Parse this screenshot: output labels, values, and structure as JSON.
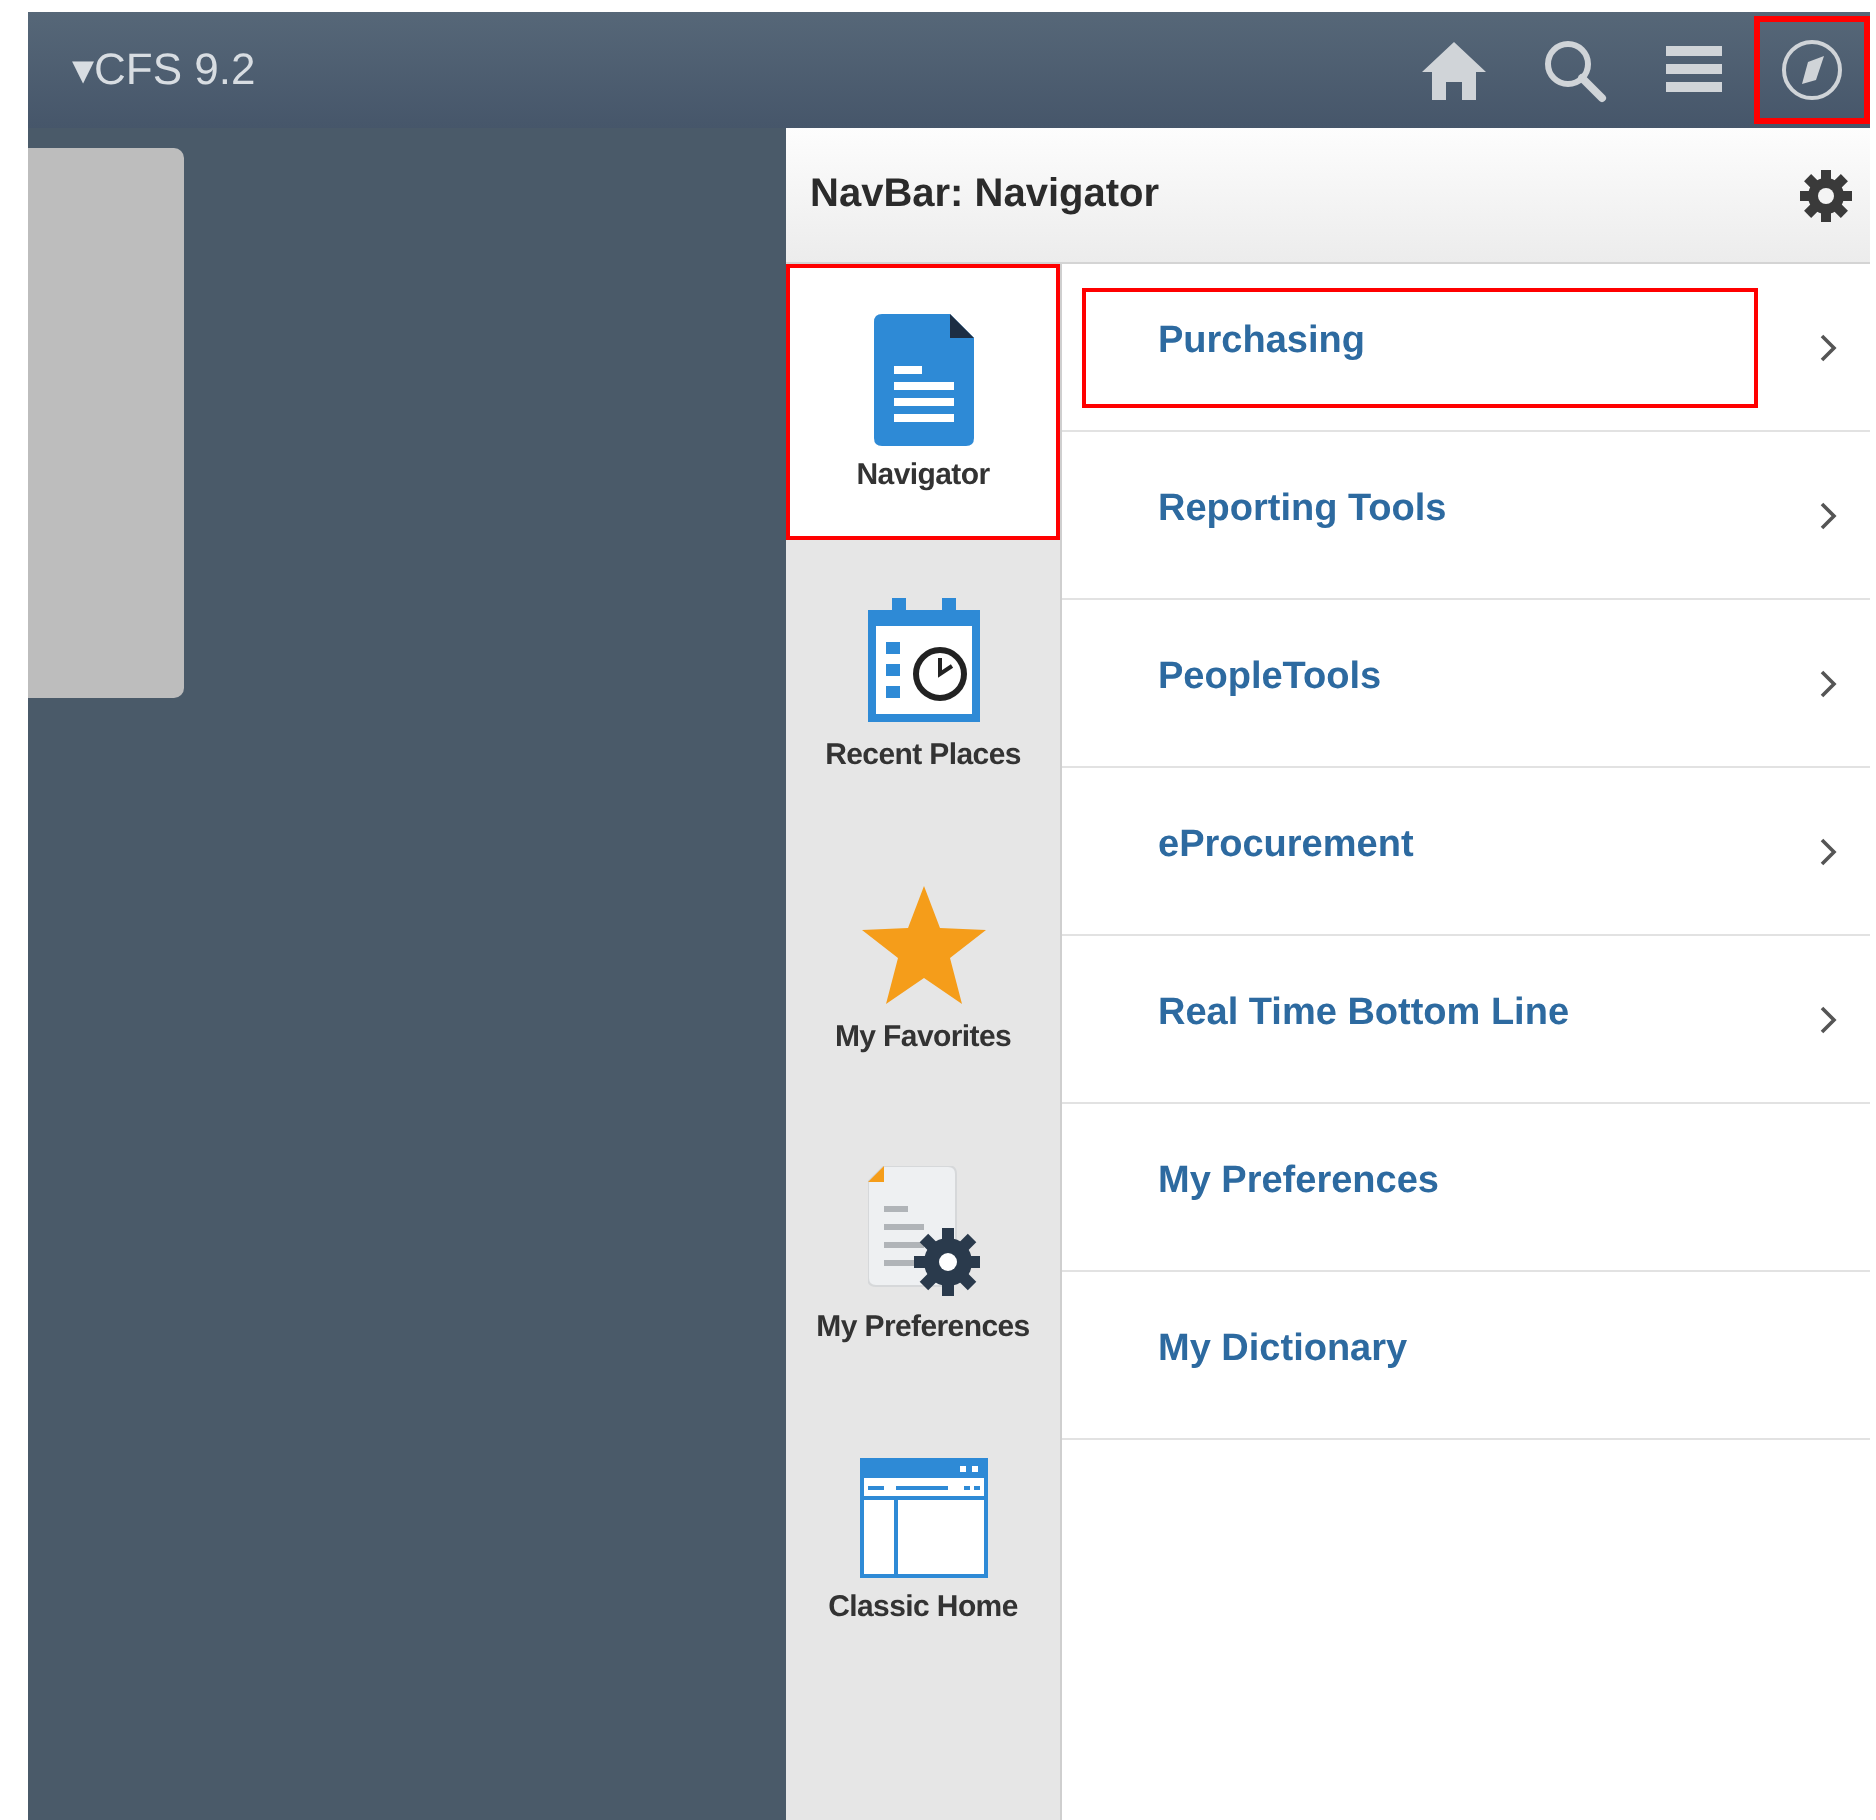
{
  "header": {
    "title": "▾CFS 9.2",
    "icons": [
      {
        "kind": "home",
        "highlighted": false
      },
      {
        "kind": "search",
        "highlighted": false
      },
      {
        "kind": "menu",
        "highlighted": false
      },
      {
        "kind": "compass",
        "highlighted": true
      }
    ]
  },
  "panel": {
    "title": "NavBar: Navigator",
    "tiles": [
      {
        "kind": "document",
        "label": "Navigator",
        "selected": true,
        "highlighted": true
      },
      {
        "kind": "calendar",
        "label": "Recent Places",
        "selected": false,
        "highlighted": false
      },
      {
        "kind": "star",
        "label": "My Favorites",
        "selected": false,
        "highlighted": false
      },
      {
        "kind": "preferences",
        "label": "My Preferences",
        "selected": false,
        "highlighted": false
      },
      {
        "kind": "classic",
        "label": "Classic Home",
        "selected": false,
        "highlighted": false
      }
    ],
    "items": [
      {
        "label": "Purchasing",
        "has_children": true,
        "highlighted": true
      },
      {
        "label": "Reporting Tools",
        "has_children": true,
        "highlighted": false
      },
      {
        "label": "PeopleTools",
        "has_children": true,
        "highlighted": false
      },
      {
        "label": "eProcurement",
        "has_children": true,
        "highlighted": false
      },
      {
        "label": "Real Time Bottom Line",
        "has_children": true,
        "highlighted": false
      },
      {
        "label": "My Preferences",
        "has_children": false,
        "highlighted": false
      },
      {
        "label": "My Dictionary",
        "has_children": false,
        "highlighted": false
      }
    ]
  }
}
